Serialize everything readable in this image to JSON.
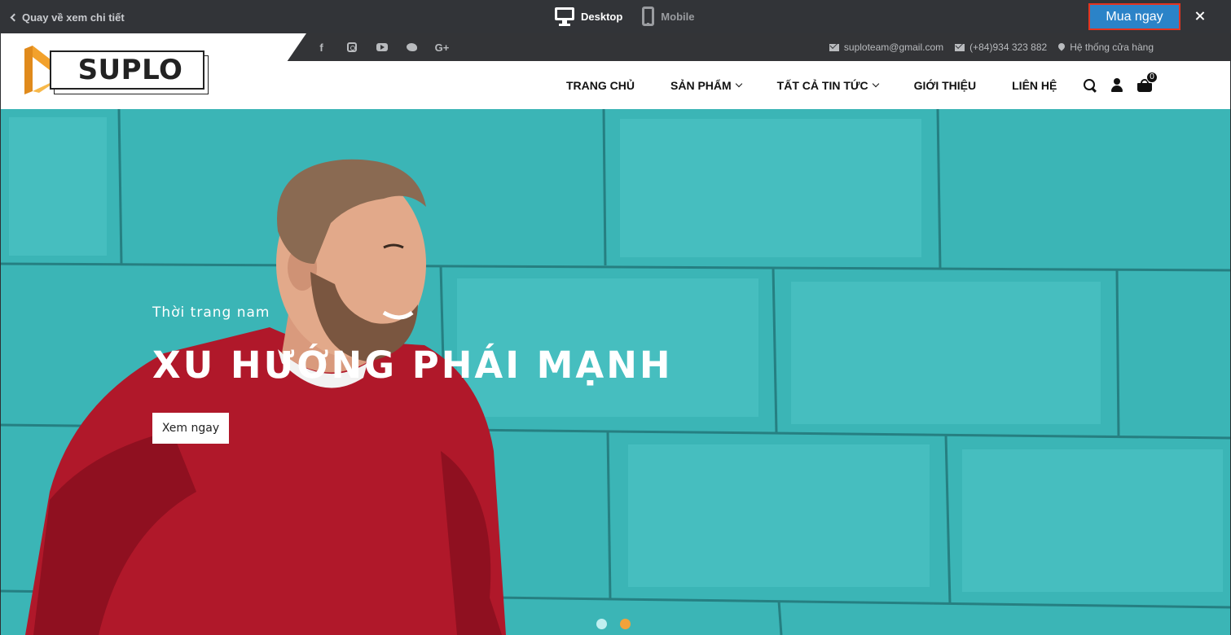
{
  "preview_bar": {
    "back_label": "Quay về xem chi tiết",
    "devices": {
      "desktop": "Desktop",
      "mobile": "Mobile"
    },
    "buy_label": "Mua ngay",
    "colors": {
      "buy_bg": "#2b83c8",
      "buy_border": "#e5341f",
      "bar_bg": "#323438"
    }
  },
  "topbar": {
    "social_icons": [
      "facebook-icon",
      "instagram-icon",
      "youtube-icon",
      "twitter-icon",
      "google-plus-icon"
    ],
    "email": "suploteam@gmail.com",
    "phone": "(+84)934 323 882",
    "stores": "Hệ thống cửa hàng"
  },
  "logo": {
    "text": "SUPLO",
    "accent": "#f2a12c"
  },
  "nav": {
    "items": [
      {
        "label": "TRANG CHỦ",
        "dropdown": false
      },
      {
        "label": "SẢN PHẨM",
        "dropdown": true
      },
      {
        "label": "TẤT CẢ TIN TỨC",
        "dropdown": true
      },
      {
        "label": "GIỚI THIỆU",
        "dropdown": false
      },
      {
        "label": "LIÊN HỆ",
        "dropdown": false
      }
    ],
    "cart_count": "0"
  },
  "hero": {
    "subtitle": "Thời trang nam",
    "title": "XU HƯỚNG PHÁI MẠNH",
    "button": "Xem ngay",
    "slides": 2,
    "active_slide": 2,
    "colors": {
      "wall": "#3bb5b6",
      "sweater": "#b0182a",
      "dot_inactive": "#bfeff0",
      "dot_active": "#f2a23a"
    }
  }
}
